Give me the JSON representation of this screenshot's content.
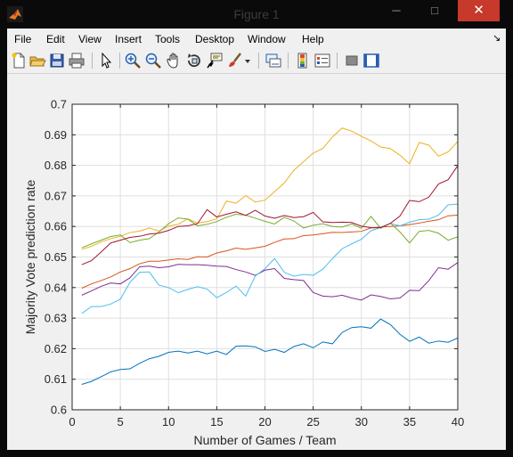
{
  "window": {
    "title": "Figure 1",
    "controls": {
      "minimize": "─",
      "maximize": "□",
      "close": "✕"
    }
  },
  "menu": {
    "items": [
      "File",
      "Edit",
      "View",
      "Insert",
      "Tools",
      "Desktop",
      "Window",
      "Help"
    ],
    "dock_arrow": "↘"
  },
  "toolbar": {
    "icons": [
      "new-figure-icon",
      "open-file-icon",
      "save-icon",
      "print-icon",
      "pointer-icon",
      "zoom-in-icon",
      "zoom-out-icon",
      "pan-icon",
      "rotate-3d-icon",
      "data-cursor-icon",
      "brush-icon",
      "brush-dropdown-icon",
      "link-plot-icon",
      "colorbar-icon",
      "legend-icon",
      "hide-plot-tools-icon",
      "show-plot-tools-icon"
    ]
  },
  "colors": {
    "series": [
      "#0072BD",
      "#D95319",
      "#EDB120",
      "#7E2F8E",
      "#77AC30",
      "#4DBEEE",
      "#A2142F"
    ],
    "close_button": "#C7392A",
    "figure_background": "#F0F0F0",
    "axes_background": "#FFFFFF"
  },
  "chart_data": {
    "type": "line",
    "title": "",
    "xlabel": "Number of Games / Team",
    "ylabel": "Majority Vote prediction rate",
    "xlim": [
      0,
      40
    ],
    "ylim": [
      0.6,
      0.7
    ],
    "xticks": [
      0,
      5,
      10,
      15,
      20,
      25,
      30,
      35,
      40
    ],
    "yticks": [
      0.6,
      0.61,
      0.62,
      0.63,
      0.64,
      0.65,
      0.66,
      0.67,
      0.68,
      0.69,
      0.7
    ],
    "grid": true,
    "x": [
      1,
      2,
      3,
      4,
      5,
      6,
      7,
      8,
      9,
      10,
      11,
      12,
      13,
      14,
      15,
      16,
      17,
      18,
      19,
      20,
      21,
      22,
      23,
      24,
      25,
      26,
      27,
      28,
      29,
      30,
      31,
      32,
      33,
      34,
      35,
      36,
      37,
      38,
      39,
      40
    ],
    "series": [
      {
        "color": "#0072BD",
        "values": [
          0.6083,
          0.6093,
          0.6108,
          0.6124,
          0.6132,
          0.6134,
          0.6152,
          0.6167,
          0.6175,
          0.6188,
          0.6192,
          0.6186,
          0.6192,
          0.6183,
          0.6192,
          0.6181,
          0.6208,
          0.6209,
          0.6206,
          0.6191,
          0.6198,
          0.6188,
          0.6207,
          0.6216,
          0.6203,
          0.6222,
          0.6216,
          0.6253,
          0.6269,
          0.6272,
          0.6267,
          0.6297,
          0.6279,
          0.6247,
          0.6224,
          0.6238,
          0.6218,
          0.6225,
          0.6221,
          0.6235
        ]
      },
      {
        "color": "#D95319",
        "values": [
          0.6398,
          0.6412,
          0.6423,
          0.6435,
          0.6451,
          0.6462,
          0.6478,
          0.6486,
          0.6486,
          0.649,
          0.6494,
          0.6492,
          0.6501,
          0.65,
          0.6513,
          0.652,
          0.6529,
          0.6525,
          0.653,
          0.6535,
          0.6548,
          0.6559,
          0.656,
          0.657,
          0.6572,
          0.6576,
          0.6581,
          0.658,
          0.6582,
          0.6584,
          0.6595,
          0.6598,
          0.66,
          0.6602,
          0.6606,
          0.6611,
          0.6617,
          0.6622,
          0.6635,
          0.6637
        ]
      },
      {
        "color": "#EDB120",
        "values": [
          0.6525,
          0.6535,
          0.6549,
          0.656,
          0.6568,
          0.658,
          0.6585,
          0.6595,
          0.6585,
          0.6601,
          0.6607,
          0.6625,
          0.6611,
          0.6616,
          0.6625,
          0.6683,
          0.6676,
          0.6701,
          0.668,
          0.6686,
          0.6714,
          0.6742,
          0.6784,
          0.6812,
          0.684,
          0.6855,
          0.6893,
          0.6922,
          0.6912,
          0.6895,
          0.688,
          0.686,
          0.6855,
          0.6833,
          0.6805,
          0.6875,
          0.6866,
          0.683,
          0.6844,
          0.6878
        ]
      },
      {
        "color": "#7E2F8E",
        "values": [
          0.6375,
          0.6389,
          0.6404,
          0.6415,
          0.6412,
          0.6432,
          0.6468,
          0.647,
          0.6465,
          0.6468,
          0.6476,
          0.6475,
          0.6475,
          0.6473,
          0.647,
          0.6469,
          0.6459,
          0.6451,
          0.644,
          0.6457,
          0.6462,
          0.643,
          0.6426,
          0.6423,
          0.6384,
          0.6372,
          0.637,
          0.6375,
          0.6366,
          0.6359,
          0.6376,
          0.6371,
          0.6363,
          0.6366,
          0.6391,
          0.639,
          0.6423,
          0.6465,
          0.646,
          0.6482
        ]
      },
      {
        "color": "#77AC30",
        "values": [
          0.653,
          0.6543,
          0.6555,
          0.6567,
          0.6572,
          0.6547,
          0.6555,
          0.656,
          0.6582,
          0.6609,
          0.6628,
          0.6624,
          0.6602,
          0.6607,
          0.6616,
          0.663,
          0.664,
          0.6637,
          0.6627,
          0.6617,
          0.6608,
          0.663,
          0.6618,
          0.6595,
          0.6604,
          0.6609,
          0.66,
          0.6598,
          0.6608,
          0.6594,
          0.6633,
          0.6594,
          0.6611,
          0.6582,
          0.6546,
          0.6584,
          0.6587,
          0.6578,
          0.6555,
          0.6566
        ]
      },
      {
        "color": "#4DBEEE",
        "values": [
          0.6315,
          0.6338,
          0.6338,
          0.6346,
          0.6362,
          0.6417,
          0.645,
          0.6451,
          0.6408,
          0.64,
          0.6383,
          0.6394,
          0.6403,
          0.6395,
          0.6367,
          0.6384,
          0.6405,
          0.6372,
          0.6438,
          0.6462,
          0.6495,
          0.645,
          0.6437,
          0.6443,
          0.644,
          0.646,
          0.6495,
          0.6527,
          0.6543,
          0.6558,
          0.6586,
          0.6597,
          0.661,
          0.6602,
          0.6614,
          0.6622,
          0.6624,
          0.6637,
          0.6671,
          0.6673
        ]
      },
      {
        "color": "#A2142F",
        "values": [
          0.6475,
          0.6488,
          0.6516,
          0.6546,
          0.6555,
          0.6564,
          0.6568,
          0.6575,
          0.6578,
          0.6587,
          0.66,
          0.6602,
          0.6609,
          0.6655,
          0.6631,
          0.664,
          0.6648,
          0.6636,
          0.6653,
          0.6634,
          0.6627,
          0.6636,
          0.6629,
          0.6632,
          0.6646,
          0.6615,
          0.6613,
          0.6614,
          0.6613,
          0.6601,
          0.6596,
          0.6596,
          0.661,
          0.6634,
          0.6685,
          0.6681,
          0.6696,
          0.6739,
          0.6753,
          0.6799
        ]
      }
    ]
  }
}
